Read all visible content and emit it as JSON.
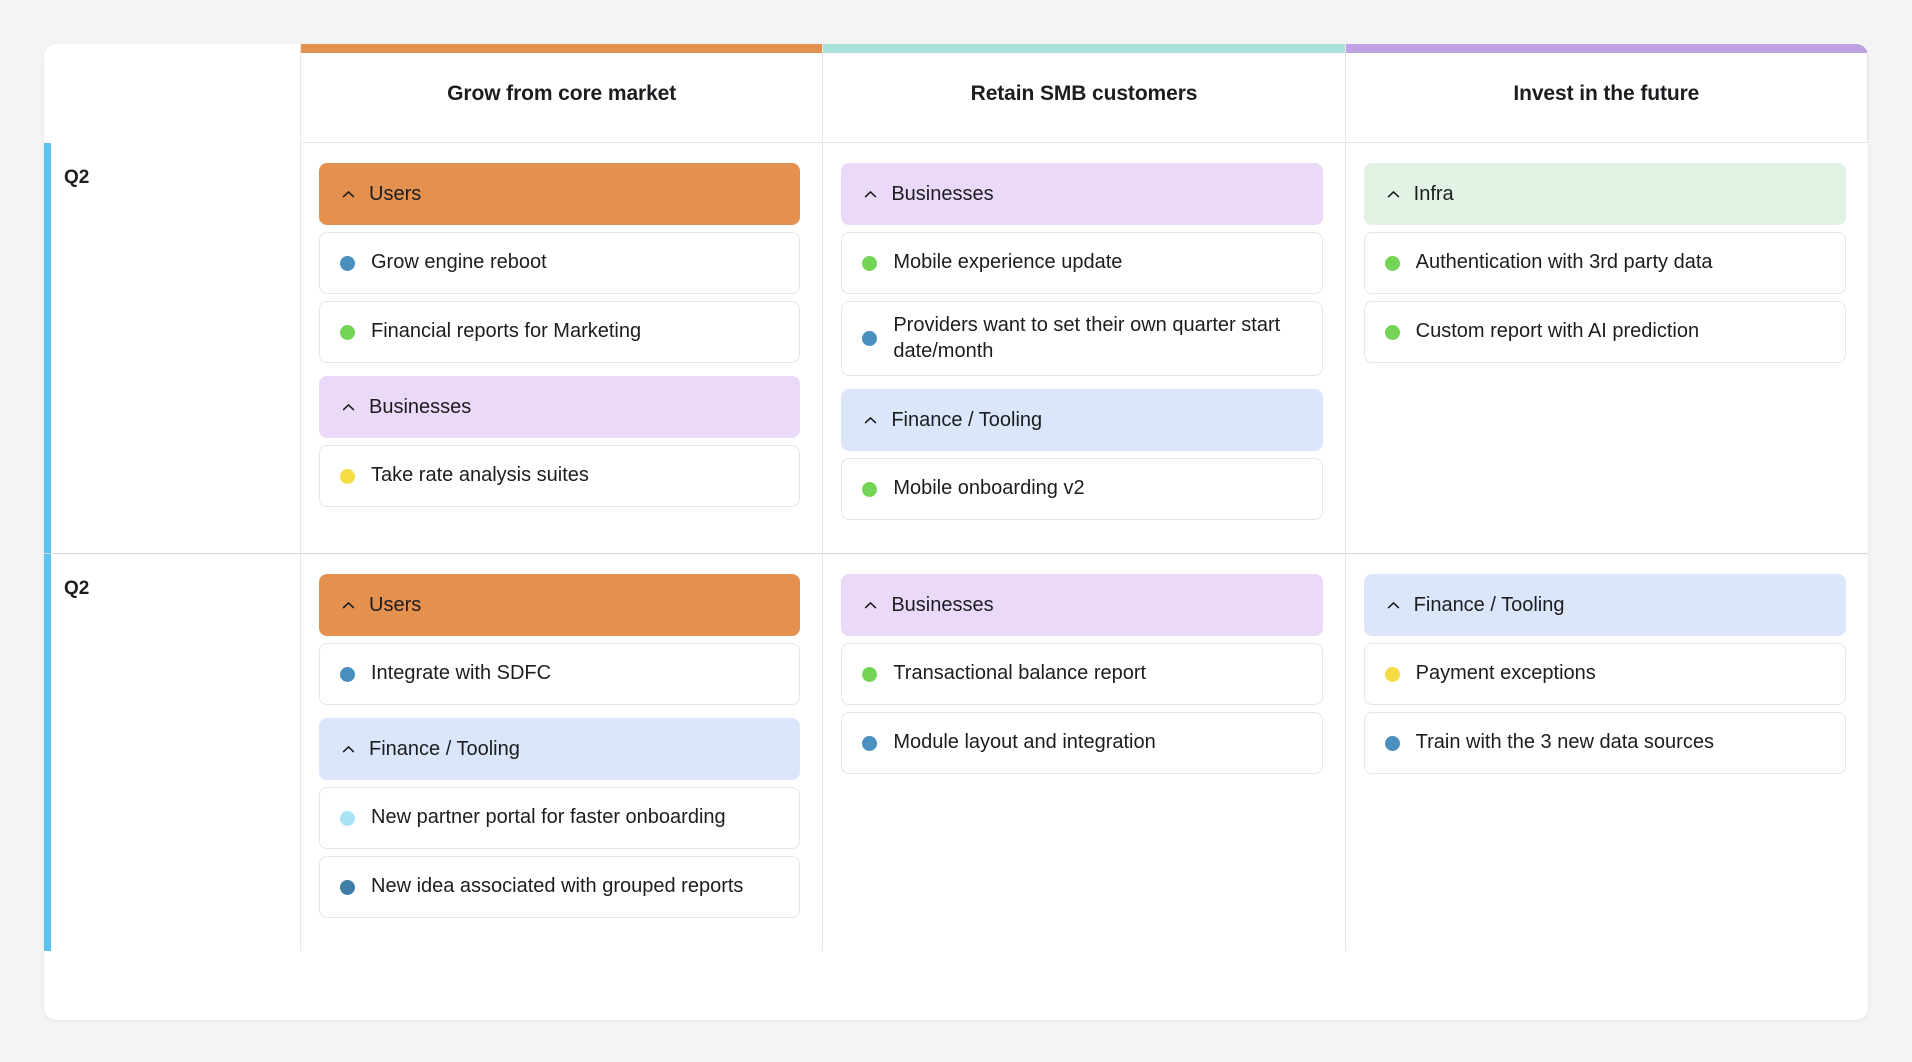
{
  "board": {
    "columns": [
      {
        "title": "Grow from core market",
        "accent": "#e4914f"
      },
      {
        "title": "Retain SMB customers",
        "accent": "#a9e2dc"
      },
      {
        "title": "Invest in the future",
        "accent": "#bfa2e3"
      }
    ],
    "row_stripe_color": "#5cc2ef",
    "group_colors": {
      "users": "#e4914f",
      "businesses": "#eaD9f8",
      "finance_tooling": "#dbe6fa",
      "infra": "#e2f2e5"
    },
    "dot_colors": {
      "blue": "#4a90bf",
      "green": "#73d456",
      "yellow": "#f5dc45",
      "cyan": "#a9e3f7",
      "steel": "#3f7da6"
    },
    "rows": [
      {
        "label": "Q2",
        "lanes": [
          {
            "groups": [
              {
                "name": "Users",
                "color": "#e4914f",
                "chevron": "chevron-up-icon",
                "items": [
                  {
                    "title": "Grow engine reboot",
                    "dot": "#4a90bf"
                  },
                  {
                    "title": "Financial reports for Marketing",
                    "dot": "#73d456"
                  }
                ]
              },
              {
                "name": "Businesses",
                "color": "#eaD9f8",
                "chevron": "chevron-up-icon",
                "items": [
                  {
                    "title": "Take rate analysis suites",
                    "dot": "#f5dc45"
                  }
                ]
              }
            ]
          },
          {
            "groups": [
              {
                "name": "Businesses",
                "color": "#eaD9f8",
                "chevron": "chevron-up-icon",
                "items": [
                  {
                    "title": "Mobile experience update",
                    "dot": "#73d456"
                  },
                  {
                    "title": "Providers want to set their own quarter start date/month",
                    "dot": "#4a90bf"
                  }
                ]
              },
              {
                "name": "Finance / Tooling",
                "color": "#dbe6fa",
                "chevron": "chevron-up-icon",
                "items": [
                  {
                    "title": "Mobile onboarding v2",
                    "dot": "#73d456"
                  }
                ]
              }
            ]
          },
          {
            "groups": [
              {
                "name": "Infra",
                "color": "#e2f2e5",
                "chevron": "chevron-up-icon",
                "items": [
                  {
                    "title": "Authentication with 3rd party data",
                    "dot": "#73d456"
                  },
                  {
                    "title": "Custom report with AI prediction",
                    "dot": "#73d456"
                  }
                ]
              }
            ]
          }
        ]
      },
      {
        "label": "Q2",
        "lanes": [
          {
            "groups": [
              {
                "name": "Users",
                "color": "#e4914f",
                "chevron": "chevron-up-icon",
                "items": [
                  {
                    "title": "Integrate with SDFC",
                    "dot": "#4a90bf"
                  }
                ]
              },
              {
                "name": "Finance / Tooling",
                "color": "#dbe6fa",
                "chevron": "chevron-up-icon",
                "items": [
                  {
                    "title": "New partner portal for faster onboarding",
                    "dot": "#a9e3f7"
                  },
                  {
                    "title": "New idea associated with grouped reports",
                    "dot": "#3f7da6"
                  }
                ]
              }
            ]
          },
          {
            "groups": [
              {
                "name": "Businesses",
                "color": "#eaD9f8",
                "chevron": "chevron-up-icon",
                "items": [
                  {
                    "title": "Transactional balance report",
                    "dot": "#73d456"
                  },
                  {
                    "title": "Module layout and integration",
                    "dot": "#4a90bf"
                  }
                ]
              }
            ]
          },
          {
            "groups": [
              {
                "name": "Finance / Tooling",
                "color": "#dbe6fa",
                "chevron": "chevron-up-icon",
                "items": [
                  {
                    "title": "Payment exceptions",
                    "dot": "#f5dc45"
                  },
                  {
                    "title": "Train with the 3 new data sources",
                    "dot": "#4a90bf"
                  }
                ]
              }
            ]
          }
        ]
      }
    ]
  }
}
